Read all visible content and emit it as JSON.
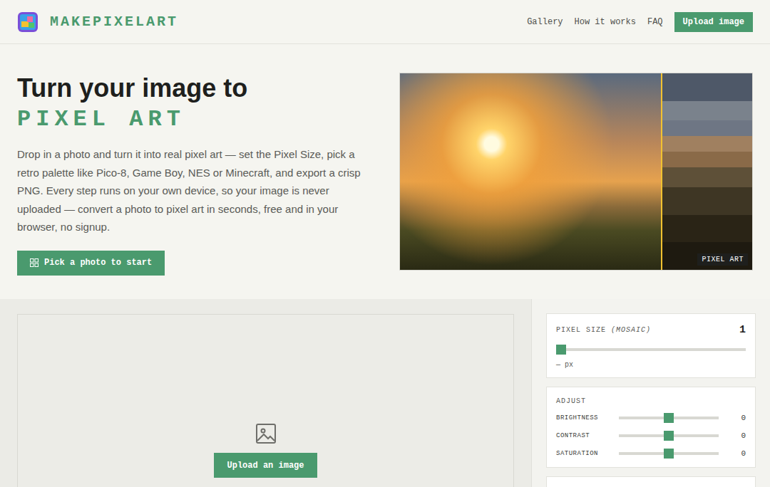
{
  "header": {
    "logo": "MAKEPIXELART",
    "nav": [
      "Gallery",
      "How it works",
      "FAQ"
    ],
    "cta": "Upload image"
  },
  "hero": {
    "title": "Turn your image to",
    "highlight": "PIXEL ART",
    "description": "Drop in a photo and turn it into real pixel art — set the Pixel Size, pick a retro palette like Pico-8, Game Boy, NES or Minecraft, and export a crisp PNG. Every step runs on your own device, so your image is never uploaded — convert a photo to pixel art in seconds, free and in your browser, no signup.",
    "button": "Pick a photo to start",
    "preview": {
      "badge": "PIXEL ART",
      "level": 0.74
    }
  },
  "editor": {
    "upload_button": "Upload an image",
    "pixel_size": {
      "label": "PIXEL SIZE",
      "hint": "(MOSAIC)",
      "value": "1",
      "level": 0,
      "unit": "— px"
    },
    "adjust": {
      "title": "ADJUST",
      "sliders": [
        {
          "label": "BRIGHTNESS",
          "value": "0",
          "level": 0.5
        },
        {
          "label": "CONTRAST",
          "value": "0",
          "level": 0.5
        },
        {
          "label": "SATURATION",
          "value": "0",
          "level": 0.5
        }
      ]
    }
  }
}
